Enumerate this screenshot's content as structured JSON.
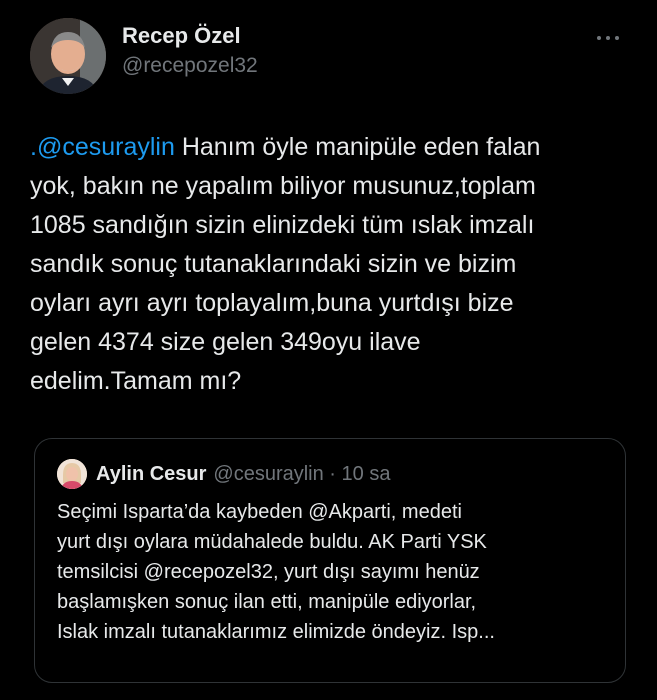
{
  "author": {
    "display_name": "Recep Özel",
    "handle": "@recepozel32"
  },
  "tweet": {
    "mention": ".@cesuraylin",
    "text": " Hanım öyle manipüle eden falan\nyok, bakın ne yapalım biliyor musunuz,toplam\n1085 sandığın sizin elinizdeki tüm ıslak imzalı\nsandık sonuç tutanaklarındaki sizin ve bizim\noyları ayrı ayrı toplayalım,buna yurtdışı bize\ngelen 4374 size gelen 349oyu ilave\nedelim.Tamam mı?"
  },
  "quoted_tweet": {
    "display_name": "Aylin Cesur",
    "handle_time": "@cesuraylin · 10 sa",
    "text": "Seçimi Isparta’da kaybeden @Akparti, medeti\nyurt dışı oylara müdahalede buldu. AK Parti YSK\ntemsilcisi @recepozel32, yurt dışı sayımı henüz\nbaşlamışken sonuç ilan etti, manipüle ediyorlar,\nIslak imzalı tutanaklarımız elimizde öndeyiz. Isp..."
  },
  "icons": {
    "more": "more-horizontal-icon"
  },
  "colors": {
    "background": "#000000",
    "text": "#e7e9ea",
    "secondary": "#71767b",
    "link": "#1d9bf0",
    "border": "#2f3336"
  }
}
